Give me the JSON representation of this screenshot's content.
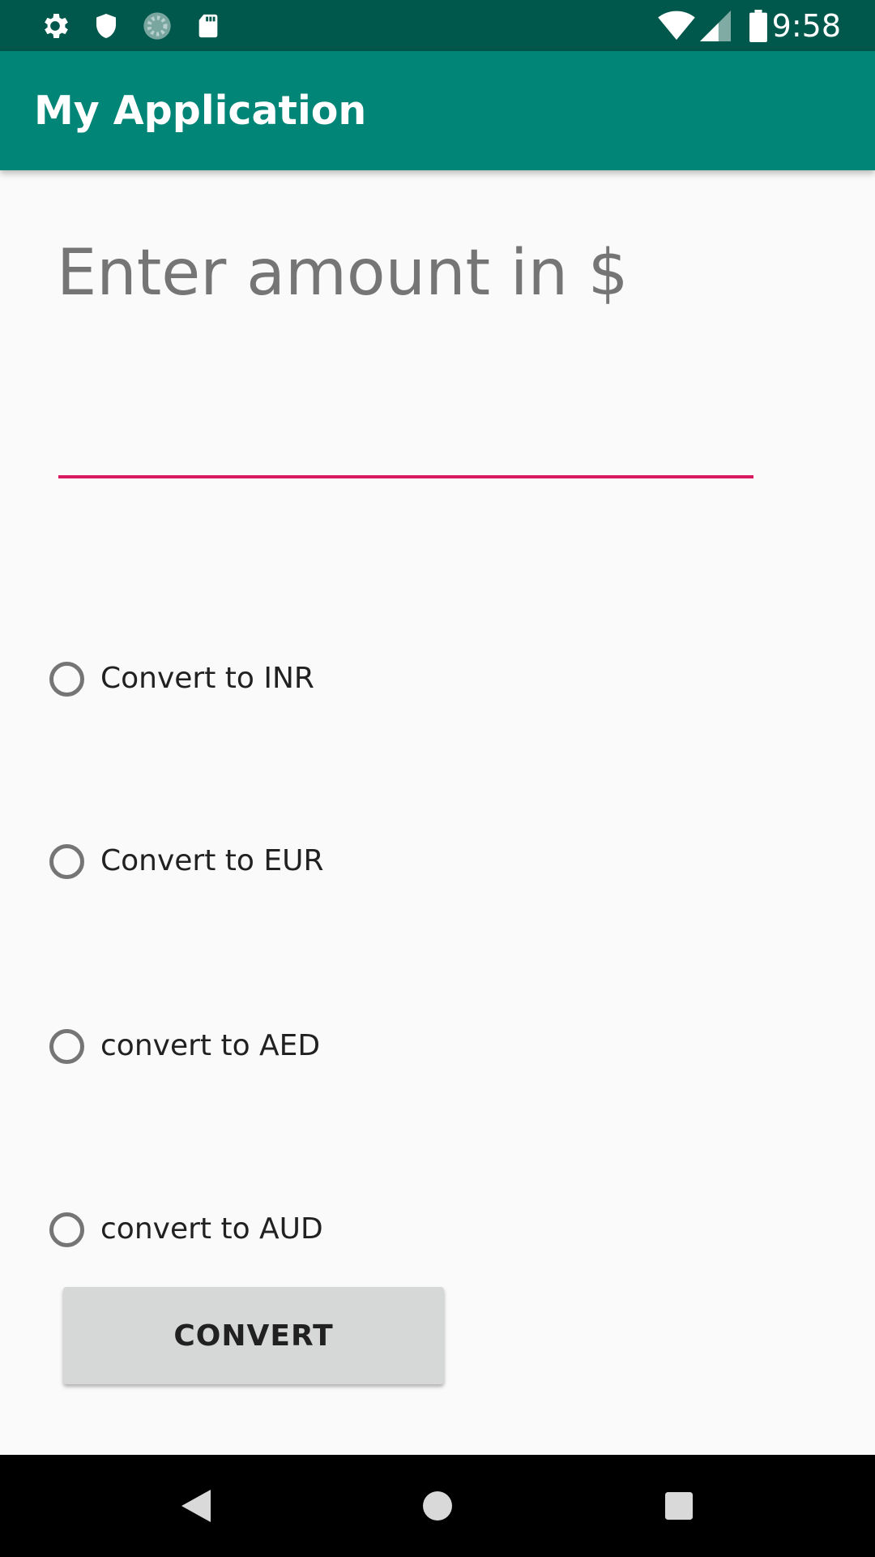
{
  "status_bar": {
    "time": "9:58",
    "left_icons": [
      "gear-icon",
      "shield-icon",
      "sync-icon",
      "sd-card-icon"
    ],
    "right_icons": [
      "wifi-icon",
      "cell-signal-icon",
      "battery-icon"
    ]
  },
  "app_bar": {
    "title": "My Application"
  },
  "main": {
    "amount_label": "Enter amount in $",
    "amount_input": {
      "value": "",
      "placeholder": ""
    },
    "options": [
      {
        "label": "Convert to INR",
        "checked": false
      },
      {
        "label": "Convert to EUR",
        "checked": false
      },
      {
        "label": "convert to AED",
        "checked": false
      },
      {
        "label": "convert to AUD",
        "checked": false
      }
    ],
    "convert_label": "CONVERT"
  },
  "nav_bar": {
    "buttons": [
      "back-icon",
      "home-icon",
      "recents-icon"
    ]
  },
  "colors": {
    "status_bar": "#00574b",
    "app_bar": "#008577",
    "accent": "#d81b60",
    "background": "#fafafa",
    "button": "#d6d7d7"
  }
}
